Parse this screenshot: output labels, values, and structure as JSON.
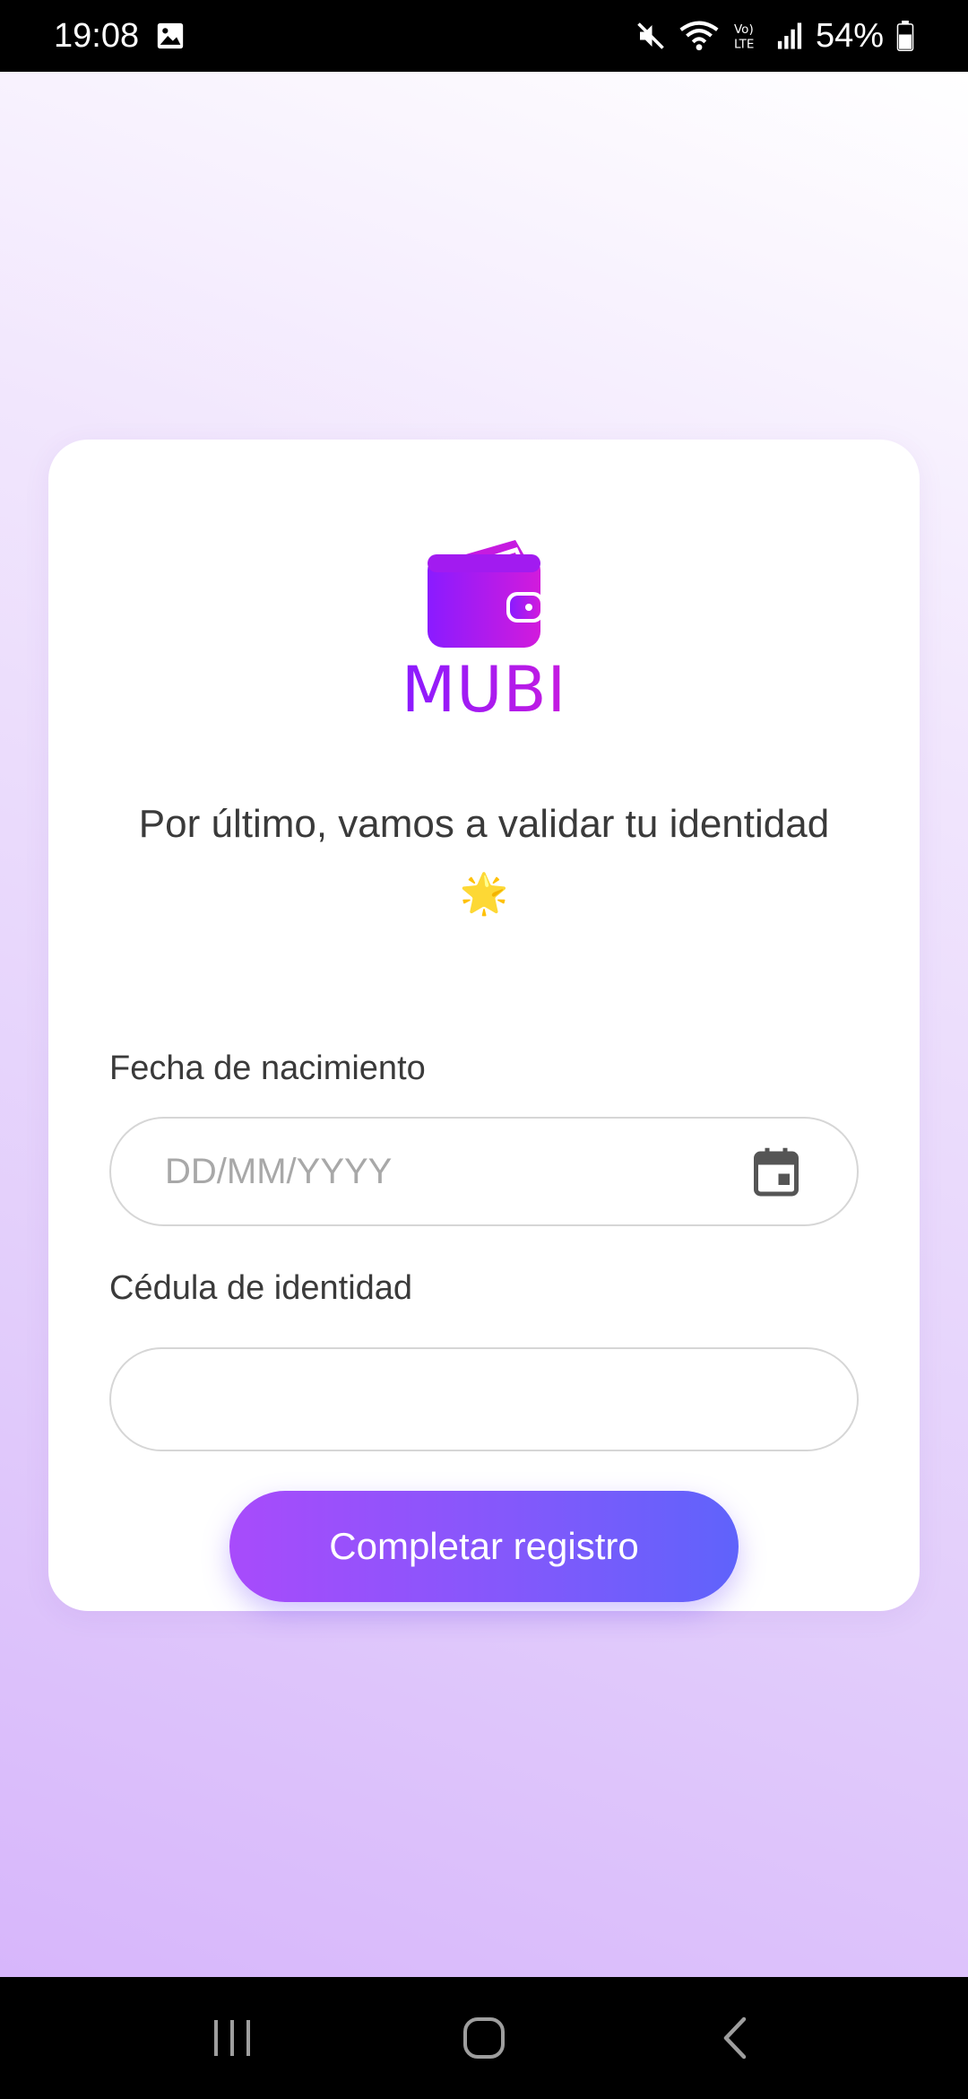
{
  "status_bar": {
    "time": "19:08",
    "battery": "54%",
    "icons": [
      "image-icon",
      "mute-icon",
      "wifi-icon",
      "volte-icon",
      "signal-icon",
      "battery-icon"
    ]
  },
  "logo": {
    "text": "MUBI",
    "icon": "wallet-icon"
  },
  "headline": "Por último, vamos a validar tu identidad 🌟",
  "form": {
    "birth_label": "Fecha de nacimiento",
    "birth_placeholder": "DD/MM/YYYY",
    "birth_value": "",
    "id_label": "Cédula de identidad",
    "id_placeholder": "",
    "id_value": "",
    "submit_label": "Completar registro"
  },
  "colors": {
    "accent_start": "#a84bfb",
    "accent_end": "#5f63fb",
    "logo": "#8a1bff"
  },
  "nav_bar": {
    "buttons": [
      "recents-icon",
      "home-icon",
      "back-icon"
    ]
  }
}
